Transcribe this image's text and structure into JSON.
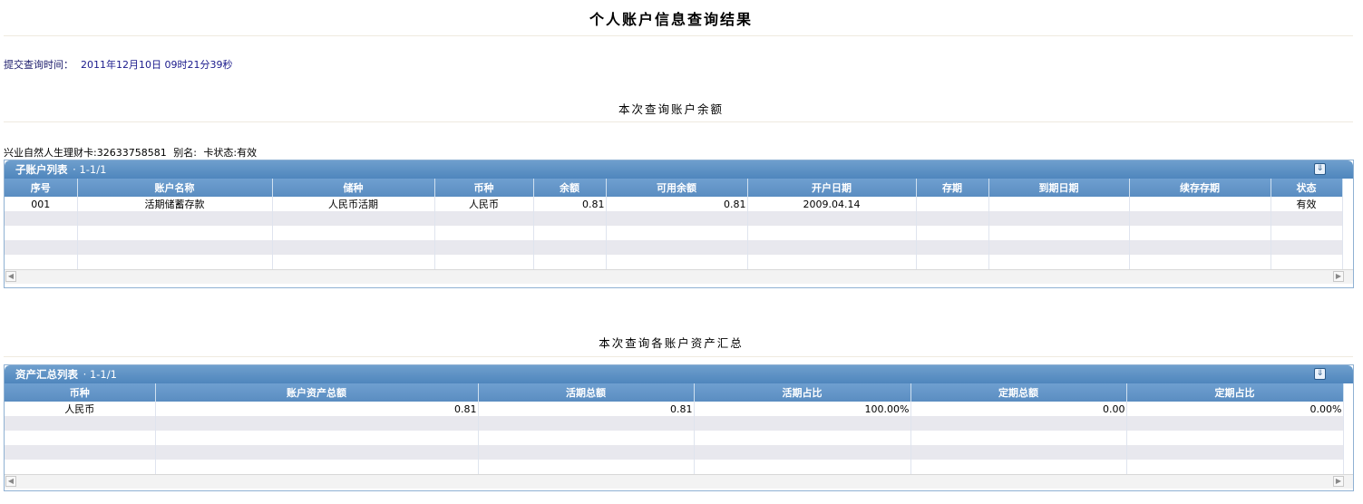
{
  "page": {
    "title": "个人账户信息查询结果",
    "submit_label": "提交查询时间：",
    "submit_time": "2011年12月10日  09时21分39秒"
  },
  "balance_section": {
    "title": "本次查询账户余额",
    "card_desc": "兴业自然人生理财卡:32633758581",
    "alias_label": "别名:",
    "status_text": "卡状态:有效",
    "panel_title": "子账户列表",
    "panel_count": "· 1-1/1",
    "collapse_icon": "chevron-double-down-icon",
    "columns": [
      "序号",
      "账户名称",
      "储种",
      "币种",
      "余额",
      "可用余额",
      "开户日期",
      "存期",
      "到期日期",
      "续存存期",
      "状态"
    ],
    "rows": [
      [
        "001",
        "活期储蓄存款",
        "人民币活期",
        "人民币",
        "0.81",
        "0.81",
        "2009.04.14",
        "",
        "",
        "",
        "有效"
      ]
    ]
  },
  "summary_section": {
    "title": "本次查询各账户资产汇总",
    "panel_title": "资产汇总列表",
    "panel_count": "· 1-1/1",
    "collapse_icon": "chevron-double-down-icon",
    "columns": [
      "币种",
      "账户资产总额",
      "活期总额",
      "活期占比",
      "定期总额",
      "定期占比"
    ],
    "rows": [
      [
        "人民币",
        "0.81",
        "0.81",
        "100.00%",
        "0.00",
        "0.00%"
      ]
    ]
  },
  "colors": {
    "header_blue": "#5a8dc1",
    "row_stripe": "#e8e8ee",
    "label_navy": "#1a1a6b"
  }
}
